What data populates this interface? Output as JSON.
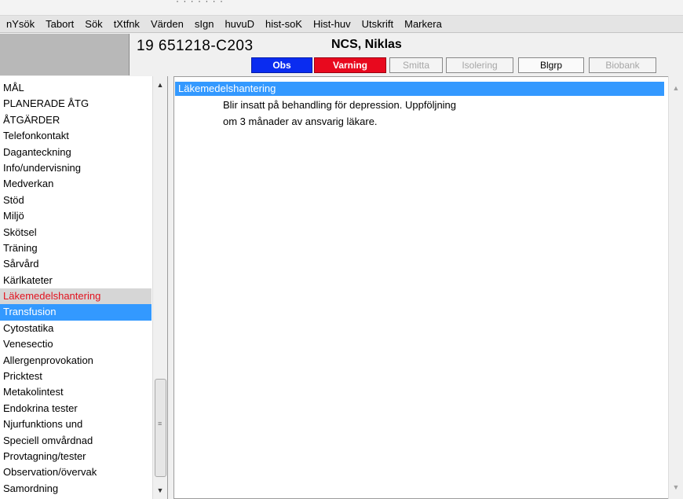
{
  "menu": [
    "nYsök",
    "Tabort",
    "Sök",
    "tXtfnk",
    "Värden",
    "sIgn",
    "huvuD",
    "hist-soK",
    "Hist-huv",
    "Utskrift",
    "Markera"
  ],
  "patient": {
    "id": "19 651218-C203",
    "name": "NCS, Niklas"
  },
  "flags": {
    "obs": "Obs",
    "varning": "Varning",
    "smitta": "Smitta",
    "isolering": "Isolering",
    "blgrp": "Blgrp",
    "biobank": "Biobank"
  },
  "colors": {
    "obs": "#0a2cf0",
    "varning": "#e8091e",
    "selection": "#3399ff",
    "marked_text": "#e2121e"
  },
  "sidebar": {
    "items": [
      "MÅL",
      "PLANERADE ÅTG",
      "ÅTGÄRDER",
      "Telefonkontakt",
      "Daganteckning",
      "Info/undervisning",
      "Medverkan",
      "Stöd",
      "Miljö",
      "Skötsel",
      "Träning",
      "Sårvård",
      "Kärlkateter",
      "Läkemedelshantering",
      "Transfusion",
      "Cytostatika",
      "Venesectio",
      "Allergenprovokation",
      "Pricktest",
      "Metakolintest",
      "Endokrina tester",
      "Njurfunktions und",
      "Speciell omvårdnad",
      "Provtagning/tester",
      "Observation/övervak",
      "Samordning"
    ],
    "marked_index": 13,
    "selected_index": 14
  },
  "content": {
    "header": "Läkemedelshantering",
    "lines": [
      "Blir insatt på behandling för depression. Uppföljning",
      "om 3 månader av ansvarig läkare."
    ]
  }
}
